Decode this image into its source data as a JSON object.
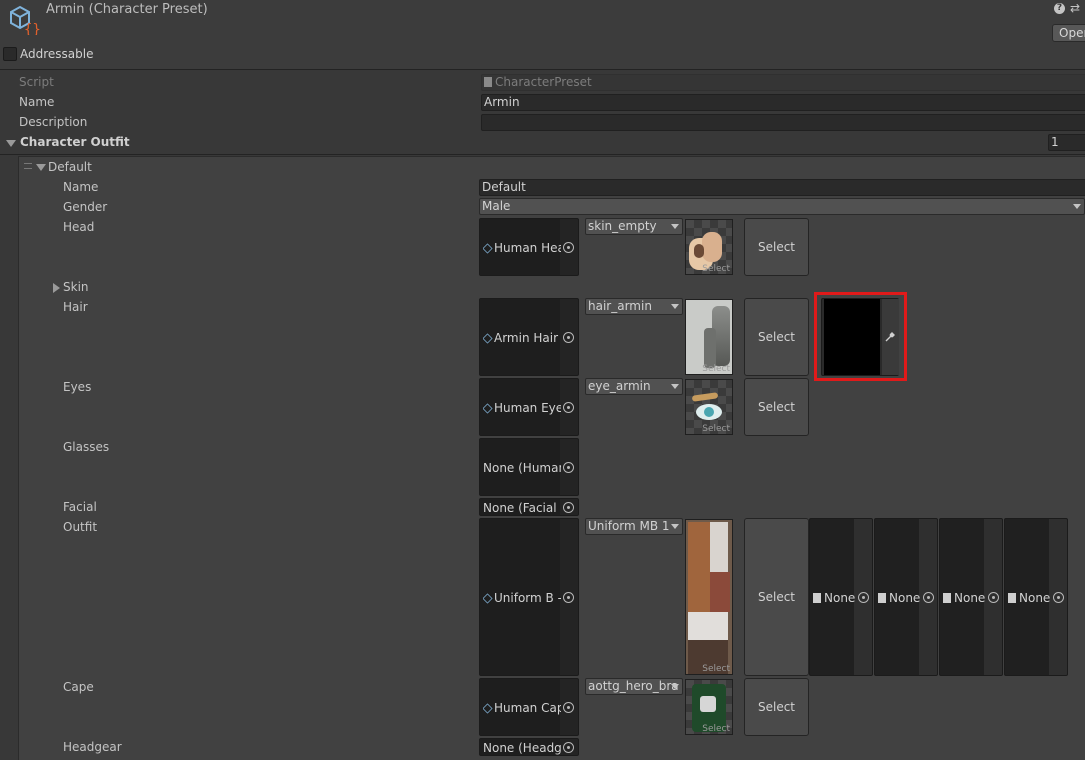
{
  "header": {
    "title": "Armin (Character Preset)",
    "open_label": "Open",
    "addressable_label": "Addressable"
  },
  "fields": {
    "script_label": "Script",
    "script_value": "CharacterPreset",
    "name_label": "Name",
    "name_value": "Armin",
    "description_label": "Description",
    "description_value": ""
  },
  "outfit": {
    "label": "Character Outfit",
    "count": "1",
    "element_label": "Default",
    "name_label": "Name",
    "name_value": "Default",
    "gender_label": "Gender",
    "gender_value": "Male",
    "skin_label": "Skin"
  },
  "rows": {
    "head": {
      "label": "Head",
      "object": "Human Hea",
      "variant": "skin_empty",
      "select": "Select"
    },
    "hair": {
      "label": "Hair",
      "object": "Armin Hair (",
      "variant": "hair_armin",
      "select": "Select",
      "color": "#000000"
    },
    "eyes": {
      "label": "Eyes",
      "object": "Human Eye",
      "variant": "eye_armin",
      "select": "Select"
    },
    "glasses": {
      "label": "Glasses",
      "object": "None (Human"
    },
    "facial": {
      "label": "Facial",
      "object": "None (Facial C"
    },
    "outfit": {
      "label": "Outfit",
      "object": "Uniform B -",
      "variant": "Uniform MB 1",
      "select": "Select",
      "slots": [
        "None",
        "None",
        "None",
        "None"
      ]
    },
    "cape": {
      "label": "Cape",
      "object": "Human Cap",
      "variant": "aottg_hero_bra",
      "select": "Select"
    },
    "headgear": {
      "label": "Headgear",
      "object": "None (Headge"
    }
  },
  "thumb_select": "Select"
}
